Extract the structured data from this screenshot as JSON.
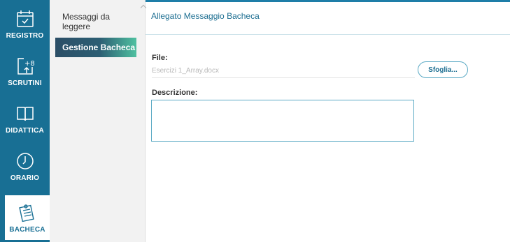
{
  "rail": {
    "items": [
      {
        "label": "REGISTRO",
        "icon": "calendar-check-icon"
      },
      {
        "label": "SCRUTINI",
        "icon": "plus-eight-icon"
      },
      {
        "label": "DIDATTICA",
        "icon": "book-icon"
      },
      {
        "label": "ORARIO",
        "icon": "clock-icon"
      },
      {
        "label": "BACHECA",
        "icon": "notice-board-icon"
      }
    ],
    "active_index": 4,
    "background_color": "#186f94"
  },
  "menu": {
    "items": [
      {
        "label": "Messaggi da leggere"
      },
      {
        "label": "Gestione Bacheca"
      }
    ],
    "active_index": 1
  },
  "main": {
    "title": "Allegato Messaggio Bacheca",
    "file_label": "File:",
    "file_value": "Esercizi 1_Array.docx",
    "browse_label": "Sfoglia...",
    "description_label": "Descrizione:",
    "description_value": ""
  }
}
